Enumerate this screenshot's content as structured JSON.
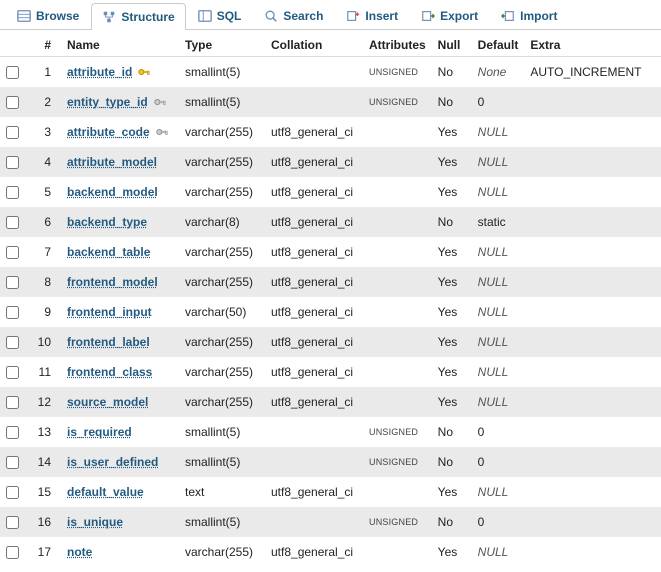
{
  "tabs": [
    {
      "id": "browse",
      "label": "Browse",
      "icon": "browse"
    },
    {
      "id": "structure",
      "label": "Structure",
      "icon": "structure",
      "active": true
    },
    {
      "id": "sql",
      "label": "SQL",
      "icon": "sql"
    },
    {
      "id": "search",
      "label": "Search",
      "icon": "search"
    },
    {
      "id": "insert",
      "label": "Insert",
      "icon": "insert"
    },
    {
      "id": "export",
      "label": "Export",
      "icon": "export"
    },
    {
      "id": "import",
      "label": "Import",
      "icon": "import"
    }
  ],
  "columns": {
    "num": "#",
    "name": "Name",
    "type": "Type",
    "collation": "Collation",
    "attributes": "Attributes",
    "null": "Null",
    "default": "Default",
    "extra": "Extra"
  },
  "rows": [
    {
      "n": 1,
      "name": "attribute_id",
      "key": "primary",
      "type": "smallint(5)",
      "collation": "",
      "attributes": "UNSIGNED",
      "null": "No",
      "default": "None",
      "default_italic": true,
      "extra": "AUTO_INCREMENT"
    },
    {
      "n": 2,
      "name": "entity_type_id",
      "key": "index",
      "type": "smallint(5)",
      "collation": "",
      "attributes": "UNSIGNED",
      "null": "No",
      "default": "0",
      "extra": ""
    },
    {
      "n": 3,
      "name": "attribute_code",
      "key": "index",
      "type": "varchar(255)",
      "collation": "utf8_general_ci",
      "attributes": "",
      "null": "Yes",
      "default": "NULL",
      "default_italic": true,
      "extra": ""
    },
    {
      "n": 4,
      "name": "attribute_model",
      "type": "varchar(255)",
      "collation": "utf8_general_ci",
      "attributes": "",
      "null": "Yes",
      "default": "NULL",
      "default_italic": true,
      "extra": ""
    },
    {
      "n": 5,
      "name": "backend_model",
      "type": "varchar(255)",
      "collation": "utf8_general_ci",
      "attributes": "",
      "null": "Yes",
      "default": "NULL",
      "default_italic": true,
      "extra": ""
    },
    {
      "n": 6,
      "name": "backend_type",
      "type": "varchar(8)",
      "collation": "utf8_general_ci",
      "attributes": "",
      "null": "No",
      "default": "static",
      "extra": ""
    },
    {
      "n": 7,
      "name": "backend_table",
      "type": "varchar(255)",
      "collation": "utf8_general_ci",
      "attributes": "",
      "null": "Yes",
      "default": "NULL",
      "default_italic": true,
      "extra": ""
    },
    {
      "n": 8,
      "name": "frontend_model",
      "type": "varchar(255)",
      "collation": "utf8_general_ci",
      "attributes": "",
      "null": "Yes",
      "default": "NULL",
      "default_italic": true,
      "extra": ""
    },
    {
      "n": 9,
      "name": "frontend_input",
      "type": "varchar(50)",
      "collation": "utf8_general_ci",
      "attributes": "",
      "null": "Yes",
      "default": "NULL",
      "default_italic": true,
      "extra": ""
    },
    {
      "n": 10,
      "name": "frontend_label",
      "type": "varchar(255)",
      "collation": "utf8_general_ci",
      "attributes": "",
      "null": "Yes",
      "default": "NULL",
      "default_italic": true,
      "extra": ""
    },
    {
      "n": 11,
      "name": "frontend_class",
      "type": "varchar(255)",
      "collation": "utf8_general_ci",
      "attributes": "",
      "null": "Yes",
      "default": "NULL",
      "default_italic": true,
      "extra": ""
    },
    {
      "n": 12,
      "name": "source_model",
      "type": "varchar(255)",
      "collation": "utf8_general_ci",
      "attributes": "",
      "null": "Yes",
      "default": "NULL",
      "default_italic": true,
      "extra": ""
    },
    {
      "n": 13,
      "name": "is_required",
      "type": "smallint(5)",
      "collation": "",
      "attributes": "UNSIGNED",
      "null": "No",
      "default": "0",
      "extra": ""
    },
    {
      "n": 14,
      "name": "is_user_defined",
      "type": "smallint(5)",
      "collation": "",
      "attributes": "UNSIGNED",
      "null": "No",
      "default": "0",
      "extra": ""
    },
    {
      "n": 15,
      "name": "default_value",
      "type": "text",
      "collation": "utf8_general_ci",
      "attributes": "",
      "null": "Yes",
      "default": "NULL",
      "default_italic": true,
      "extra": ""
    },
    {
      "n": 16,
      "name": "is_unique",
      "type": "smallint(5)",
      "collation": "",
      "attributes": "UNSIGNED",
      "null": "No",
      "default": "0",
      "extra": ""
    },
    {
      "n": 17,
      "name": "note",
      "type": "varchar(255)",
      "collation": "utf8_general_ci",
      "attributes": "",
      "null": "Yes",
      "default": "NULL",
      "default_italic": true,
      "extra": ""
    }
  ]
}
